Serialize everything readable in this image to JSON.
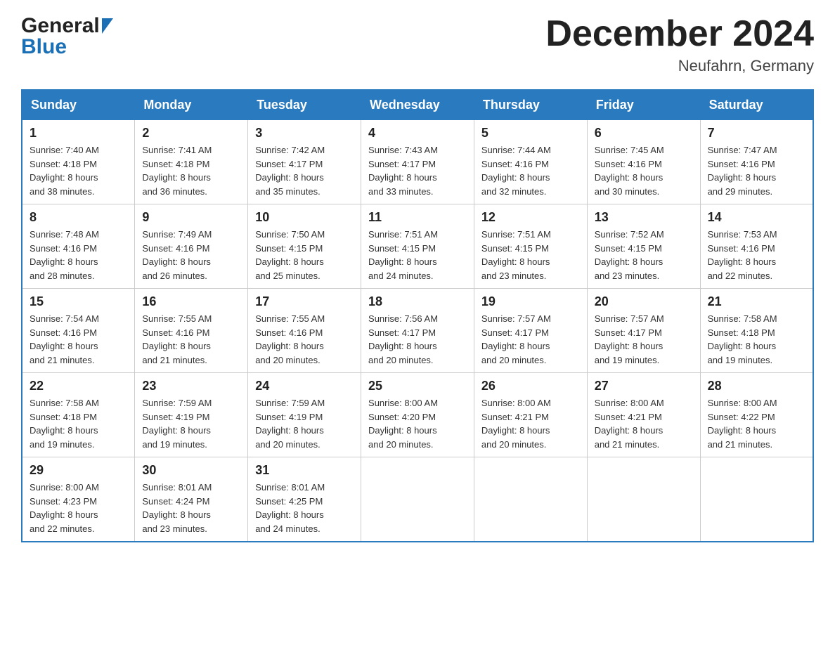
{
  "header": {
    "logo_general": "General",
    "logo_blue": "Blue",
    "title": "December 2024",
    "subtitle": "Neufahrn, Germany"
  },
  "days_of_week": [
    "Sunday",
    "Monday",
    "Tuesday",
    "Wednesday",
    "Thursday",
    "Friday",
    "Saturday"
  ],
  "weeks": [
    {
      "days": [
        {
          "num": "1",
          "sunrise": "7:40 AM",
          "sunset": "4:18 PM",
          "daylight": "8 hours and 38 minutes."
        },
        {
          "num": "2",
          "sunrise": "7:41 AM",
          "sunset": "4:18 PM",
          "daylight": "8 hours and 36 minutes."
        },
        {
          "num": "3",
          "sunrise": "7:42 AM",
          "sunset": "4:17 PM",
          "daylight": "8 hours and 35 minutes."
        },
        {
          "num": "4",
          "sunrise": "7:43 AM",
          "sunset": "4:17 PM",
          "daylight": "8 hours and 33 minutes."
        },
        {
          "num": "5",
          "sunrise": "7:44 AM",
          "sunset": "4:16 PM",
          "daylight": "8 hours and 32 minutes."
        },
        {
          "num": "6",
          "sunrise": "7:45 AM",
          "sunset": "4:16 PM",
          "daylight": "8 hours and 30 minutes."
        },
        {
          "num": "7",
          "sunrise": "7:47 AM",
          "sunset": "4:16 PM",
          "daylight": "8 hours and 29 minutes."
        }
      ]
    },
    {
      "days": [
        {
          "num": "8",
          "sunrise": "7:48 AM",
          "sunset": "4:16 PM",
          "daylight": "8 hours and 28 minutes."
        },
        {
          "num": "9",
          "sunrise": "7:49 AM",
          "sunset": "4:16 PM",
          "daylight": "8 hours and 26 minutes."
        },
        {
          "num": "10",
          "sunrise": "7:50 AM",
          "sunset": "4:15 PM",
          "daylight": "8 hours and 25 minutes."
        },
        {
          "num": "11",
          "sunrise": "7:51 AM",
          "sunset": "4:15 PM",
          "daylight": "8 hours and 24 minutes."
        },
        {
          "num": "12",
          "sunrise": "7:51 AM",
          "sunset": "4:15 PM",
          "daylight": "8 hours and 23 minutes."
        },
        {
          "num": "13",
          "sunrise": "7:52 AM",
          "sunset": "4:15 PM",
          "daylight": "8 hours and 23 minutes."
        },
        {
          "num": "14",
          "sunrise": "7:53 AM",
          "sunset": "4:16 PM",
          "daylight": "8 hours and 22 minutes."
        }
      ]
    },
    {
      "days": [
        {
          "num": "15",
          "sunrise": "7:54 AM",
          "sunset": "4:16 PM",
          "daylight": "8 hours and 21 minutes."
        },
        {
          "num": "16",
          "sunrise": "7:55 AM",
          "sunset": "4:16 PM",
          "daylight": "8 hours and 21 minutes."
        },
        {
          "num": "17",
          "sunrise": "7:55 AM",
          "sunset": "4:16 PM",
          "daylight": "8 hours and 20 minutes."
        },
        {
          "num": "18",
          "sunrise": "7:56 AM",
          "sunset": "4:17 PM",
          "daylight": "8 hours and 20 minutes."
        },
        {
          "num": "19",
          "sunrise": "7:57 AM",
          "sunset": "4:17 PM",
          "daylight": "8 hours and 20 minutes."
        },
        {
          "num": "20",
          "sunrise": "7:57 AM",
          "sunset": "4:17 PM",
          "daylight": "8 hours and 19 minutes."
        },
        {
          "num": "21",
          "sunrise": "7:58 AM",
          "sunset": "4:18 PM",
          "daylight": "8 hours and 19 minutes."
        }
      ]
    },
    {
      "days": [
        {
          "num": "22",
          "sunrise": "7:58 AM",
          "sunset": "4:18 PM",
          "daylight": "8 hours and 19 minutes."
        },
        {
          "num": "23",
          "sunrise": "7:59 AM",
          "sunset": "4:19 PM",
          "daylight": "8 hours and 19 minutes."
        },
        {
          "num": "24",
          "sunrise": "7:59 AM",
          "sunset": "4:19 PM",
          "daylight": "8 hours and 20 minutes."
        },
        {
          "num": "25",
          "sunrise": "8:00 AM",
          "sunset": "4:20 PM",
          "daylight": "8 hours and 20 minutes."
        },
        {
          "num": "26",
          "sunrise": "8:00 AM",
          "sunset": "4:21 PM",
          "daylight": "8 hours and 20 minutes."
        },
        {
          "num": "27",
          "sunrise": "8:00 AM",
          "sunset": "4:21 PM",
          "daylight": "8 hours and 21 minutes."
        },
        {
          "num": "28",
          "sunrise": "8:00 AM",
          "sunset": "4:22 PM",
          "daylight": "8 hours and 21 minutes."
        }
      ]
    },
    {
      "days": [
        {
          "num": "29",
          "sunrise": "8:00 AM",
          "sunset": "4:23 PM",
          "daylight": "8 hours and 22 minutes."
        },
        {
          "num": "30",
          "sunrise": "8:01 AM",
          "sunset": "4:24 PM",
          "daylight": "8 hours and 23 minutes."
        },
        {
          "num": "31",
          "sunrise": "8:01 AM",
          "sunset": "4:25 PM",
          "daylight": "8 hours and 24 minutes."
        },
        null,
        null,
        null,
        null
      ]
    }
  ],
  "labels": {
    "sunrise": "Sunrise:",
    "sunset": "Sunset:",
    "daylight": "Daylight:"
  }
}
